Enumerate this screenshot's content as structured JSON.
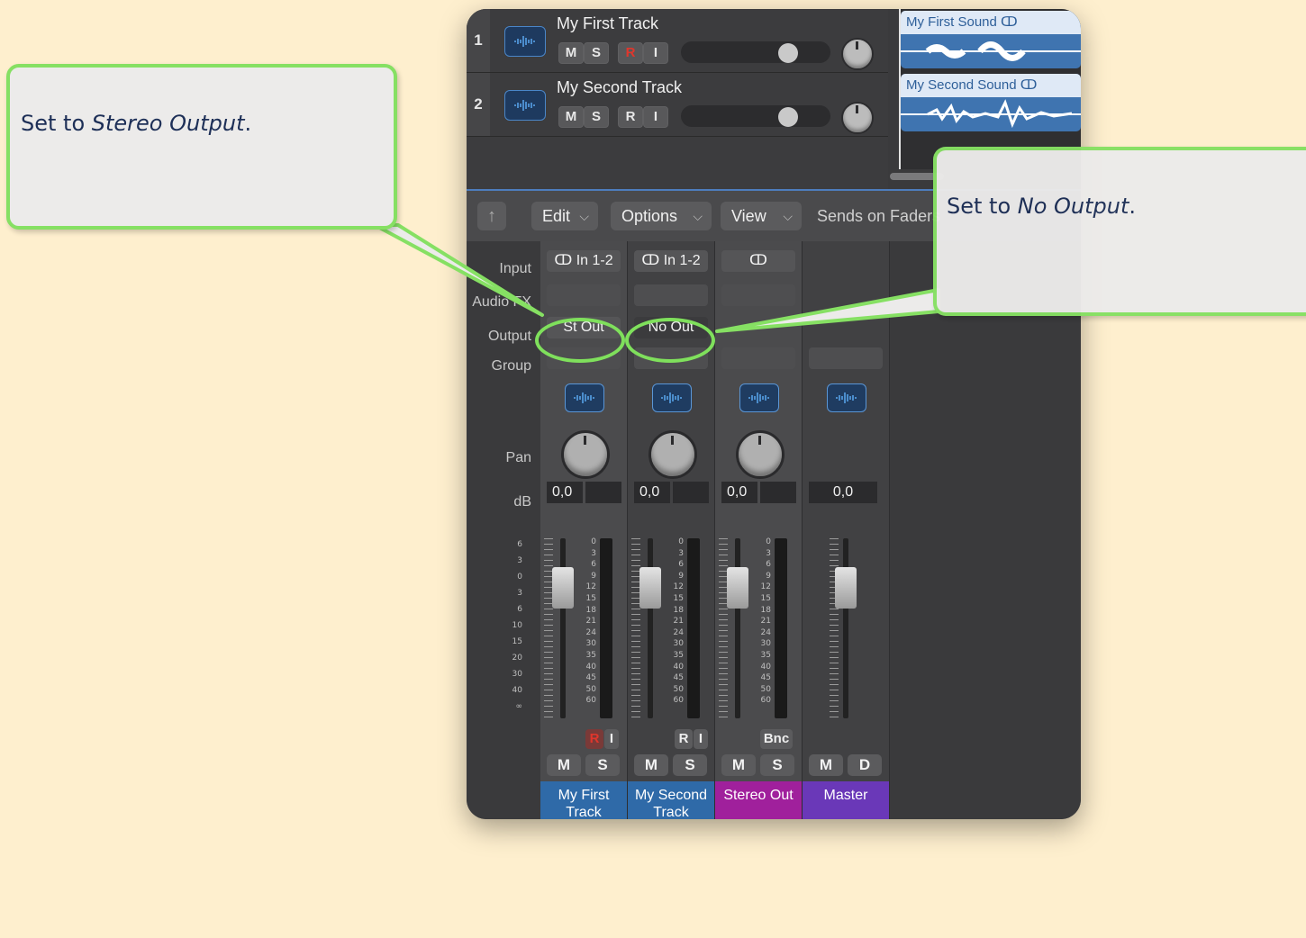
{
  "tracks": [
    {
      "number": "1",
      "name": "My First Track",
      "buttons": [
        "M",
        "S",
        "R",
        "I"
      ]
    },
    {
      "number": "2",
      "name": "My Second Track",
      "buttons": [
        "M",
        "S",
        "R",
        "I"
      ]
    }
  ],
  "regions": [
    {
      "name": "My First Sound"
    },
    {
      "name": "My Second Sound"
    }
  ],
  "toolbar": {
    "back": "↑",
    "edit": "Edit",
    "options": "Options",
    "view": "View",
    "sends": "Sends on Faders"
  },
  "row_labels": {
    "input": "Input",
    "audio_fx": "Audio FX",
    "output": "Output",
    "group": "Group",
    "pan": "Pan",
    "db": "dB"
  },
  "scale_left": [
    "6",
    "3",
    "0",
    "3",
    "6",
    "10",
    "15",
    "20",
    "30",
    "40",
    "∞"
  ],
  "scale_meter": [
    "0",
    "3",
    "6",
    "9",
    "12",
    "15",
    "18",
    "21",
    "24",
    "30",
    "35",
    "40",
    "45",
    "50",
    "60"
  ],
  "strips": [
    {
      "name_line1": "My First",
      "name_line2": "Track",
      "input": "In 1-2",
      "output": "St Out",
      "db": "0,0",
      "buttons": [
        "R",
        "I"
      ],
      "ms": [
        "M",
        "S"
      ],
      "color": "#2f6aa8"
    },
    {
      "name_line1": "My Second",
      "name_line2": "Track",
      "input": "In 1-2",
      "output": "No Out",
      "db": "0,0",
      "buttons": [
        "R",
        "I"
      ],
      "ms": [
        "M",
        "S"
      ],
      "color": "#2f6aa8"
    },
    {
      "name_line1": "Stereo Out",
      "name_line2": "",
      "input": "",
      "output": "",
      "db": "0,0",
      "buttons": [
        "Bnc"
      ],
      "ms": [
        "M",
        "S"
      ],
      "color": "#a0209c"
    },
    {
      "name_line1": "Master",
      "name_line2": "",
      "input": "",
      "output": "",
      "db": "0,0",
      "buttons": [],
      "ms": [
        "M",
        "D"
      ],
      "color": "#6a38b8"
    }
  ],
  "callouts": {
    "left": {
      "prefix": "Set to ",
      "emph": "Stereo Output",
      "suffix": "."
    },
    "right": {
      "prefix": "Set to ",
      "emph": "No Output",
      "suffix": "."
    }
  },
  "colors": {
    "background": "#feefce",
    "callout_border": "#86e063",
    "highlight": "#7fe05c",
    "record_red": "#e0362c"
  }
}
